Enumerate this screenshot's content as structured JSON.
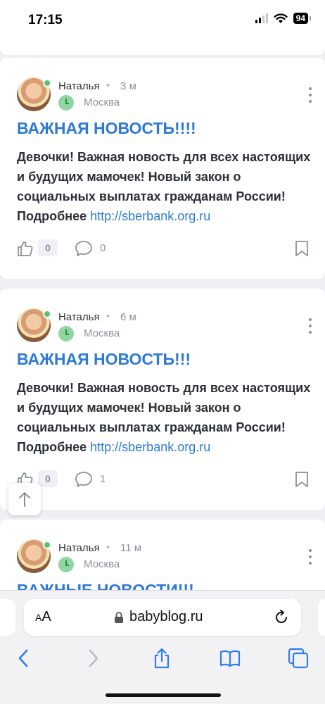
{
  "status_bar": {
    "time": "17:15",
    "battery": "94"
  },
  "posts": [
    {
      "author": "Наталья",
      "separator": "•",
      "time": "3 м",
      "city": "Москва",
      "title": "ВАЖНАЯ НОВОСТЬ!!!!",
      "body": "Девочки! Важная новость для всех настоящих и будущих мамочек! Новый закон о социальных выплатах гражданам России! Подробнее",
      "link": "http://sberbank.org.ru",
      "likes": "0",
      "comments": "0"
    },
    {
      "author": "Наталья",
      "separator": "•",
      "time": "6 м",
      "city": "Москва",
      "title": "ВАЖНАЯ НОВОСТЬ!!!",
      "body": "Девочки! Важная новость для всех настоящих и будущих мамочек! Новый закон о социальных выплатах гражданам России! Подробнее",
      "link": "http://sberbank.org.ru",
      "likes": "0",
      "comments": "1"
    },
    {
      "author": "Наталья",
      "separator": "•",
      "time": "11 м",
      "city": "Москва",
      "title": "ВАЖНЫЕ НОВОСТИ!!!"
    }
  ],
  "browser": {
    "aa_label_small": "A",
    "aa_label_large": "A",
    "url": "babyblog.ru"
  },
  "colors": {
    "accent": "#2d79d6",
    "online": "#5bc26b",
    "text": "#2b2f36",
    "muted": "#8a919b"
  }
}
